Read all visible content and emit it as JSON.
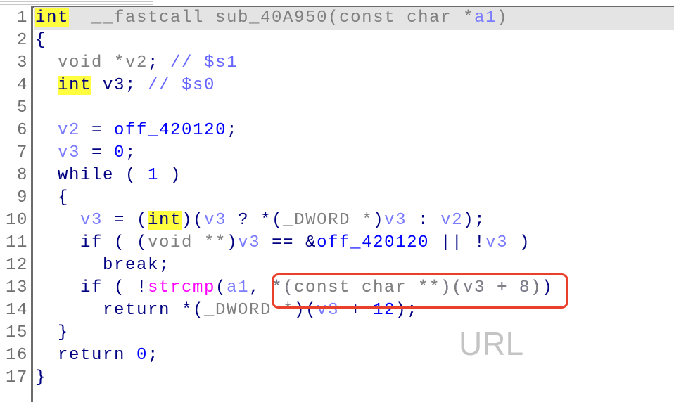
{
  "colors": {
    "keyword": "#000080",
    "type": "#808080",
    "variable": "#7b7bff",
    "global": "#0000ff",
    "function": "#ff00ff",
    "highlight": "#ffff40",
    "annotation_box": "#e8402a"
  },
  "watermark": "URL",
  "annotation": {
    "highlighted_line": 13,
    "highlighted_text": "*(const char **)(v3 + 8)"
  },
  "lines": [
    [
      [
        "int",
        "kw hl"
      ],
      [
        "  __fastcall sub_40A950(const char *",
        "ty"
      ],
      [
        "a1",
        "va"
      ],
      [
        ")",
        "ty"
      ]
    ],
    [
      [
        "{",
        "kw"
      ]
    ],
    [
      [
        "  void *",
        "ty"
      ],
      [
        "v2",
        "ty"
      ],
      [
        "; ",
        "kw"
      ],
      [
        "// $s1",
        "cm"
      ]
    ],
    [
      [
        "  ",
        ""
      ],
      [
        "int",
        "kw hl"
      ],
      [
        " v3; ",
        "kw"
      ],
      [
        "// $s0",
        "cm"
      ]
    ],
    [],
    [
      [
        "  ",
        ""
      ],
      [
        "v2",
        "va"
      ],
      [
        " = ",
        "kw"
      ],
      [
        "off_420120",
        "gl"
      ],
      [
        ";",
        "kw"
      ]
    ],
    [
      [
        "  ",
        ""
      ],
      [
        "v3",
        "va"
      ],
      [
        " = ",
        "kw"
      ],
      [
        "0",
        "gl"
      ],
      [
        ";",
        "kw"
      ]
    ],
    [
      [
        "  while ( ",
        "kw"
      ],
      [
        "1",
        "gl"
      ],
      [
        " )",
        "kw"
      ]
    ],
    [
      [
        "  {",
        "kw"
      ]
    ],
    [
      [
        "    ",
        ""
      ],
      [
        "v3",
        "va"
      ],
      [
        " = (",
        "kw"
      ],
      [
        "int",
        "kw hl"
      ],
      [
        ")(",
        "kw"
      ],
      [
        "v3",
        "va"
      ],
      [
        " ? *(",
        "kw"
      ],
      [
        "_DWORD *",
        "ty"
      ],
      [
        ")",
        "kw"
      ],
      [
        "v3",
        "va"
      ],
      [
        " : ",
        "kw"
      ],
      [
        "v2",
        "va"
      ],
      [
        ");",
        "kw"
      ]
    ],
    [
      [
        "    if ( (",
        "kw"
      ],
      [
        "void **",
        "ty"
      ],
      [
        ")",
        "kw"
      ],
      [
        "v3",
        "va"
      ],
      [
        " == &",
        "kw"
      ],
      [
        "off_420120",
        "gl"
      ],
      [
        " || !",
        "kw"
      ],
      [
        "v3",
        "va"
      ],
      [
        " )",
        "kw"
      ]
    ],
    [
      [
        "      break;",
        "kw"
      ]
    ],
    [
      [
        "    if ( !",
        "kw"
      ],
      [
        "strcmp",
        "fn"
      ],
      [
        "(",
        "kw"
      ],
      [
        "a1",
        "va"
      ],
      [
        ", *(",
        "kw"
      ],
      [
        "const char **",
        "ty"
      ],
      [
        ")(",
        "kw"
      ],
      [
        "v3",
        "va"
      ],
      [
        " + ",
        "kw"
      ],
      [
        "8",
        "gl"
      ],
      [
        "))",
        "kw"
      ]
    ],
    [
      [
        "      return *(",
        "kw"
      ],
      [
        "_DWORD *",
        "ty"
      ],
      [
        ")(",
        "kw"
      ],
      [
        "v3",
        "va"
      ],
      [
        " + ",
        "kw"
      ],
      [
        "12",
        "gl"
      ],
      [
        ");",
        "kw"
      ]
    ],
    [
      [
        "  }",
        "kw"
      ]
    ],
    [
      [
        "  return ",
        "kw"
      ],
      [
        "0",
        "gl"
      ],
      [
        ";",
        "kw"
      ]
    ],
    [
      [
        "}",
        "kw"
      ]
    ]
  ]
}
